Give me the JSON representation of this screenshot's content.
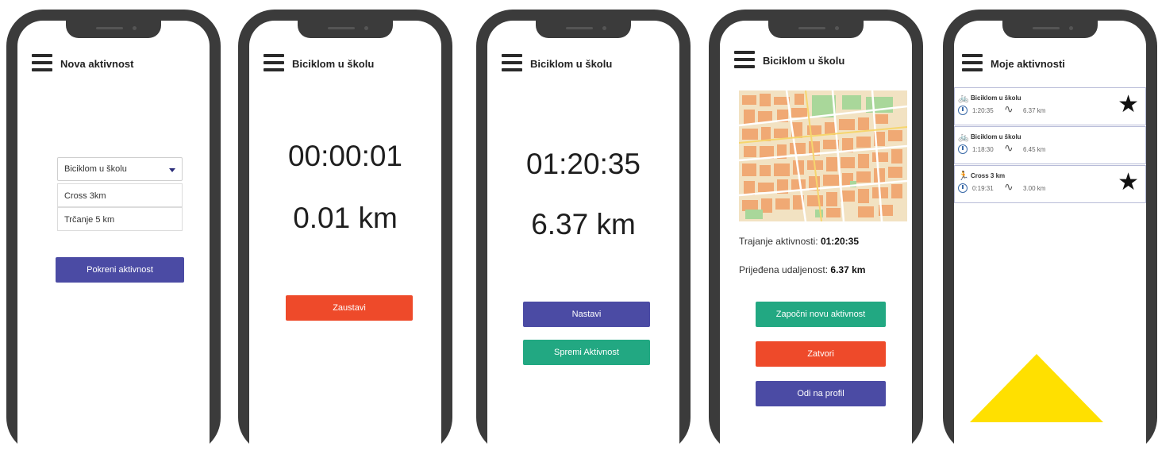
{
  "screens": [
    {
      "title": "Nova aktivnost",
      "select_value": "Biciklom u školu",
      "options": [
        "Cross 3km",
        "Trčanje 5 km"
      ],
      "button": "Pokreni aktivnost"
    },
    {
      "title": "Biciklom u školu",
      "time": "00:00:01",
      "distance": "0.01 km",
      "button": "Zaustavi"
    },
    {
      "title": "Biciklom u školu",
      "time": "01:20:35",
      "distance": "6.37 km",
      "buttons": [
        "Nastavi",
        "Spremi Aktivnost"
      ]
    },
    {
      "title": "Biciklom u školu",
      "duration_label": "Trajanje aktivnosti:",
      "duration_value": "01:20:35",
      "distance_label": "Prijeđena udaljenost:",
      "distance_value": "6.37 km",
      "buttons": [
        "Započni novu aktivnost",
        "Zatvori",
        "Odi na profil"
      ]
    },
    {
      "title": "Moje aktivnosti",
      "activities": [
        {
          "name": "Biciklom u školu",
          "duration": "1:20:35",
          "distance": "6.37 km",
          "starred": true,
          "icon": "bicycle-icon"
        },
        {
          "name": "Biciklom u školu",
          "duration": "1:18:30",
          "distance": "6.45 km",
          "starred": false,
          "icon": "bicycle-icon"
        },
        {
          "name": "Cross 3 km",
          "duration": "0:19:31",
          "distance": "3.00 km",
          "starred": true,
          "icon": "runner-icon"
        }
      ]
    }
  ],
  "colors": {
    "blue": "#4b4ba4",
    "red": "#ee4a2a",
    "green": "#22a882",
    "phone_frame": "#3b3b3b",
    "accent_yellow": "#ffe000"
  }
}
